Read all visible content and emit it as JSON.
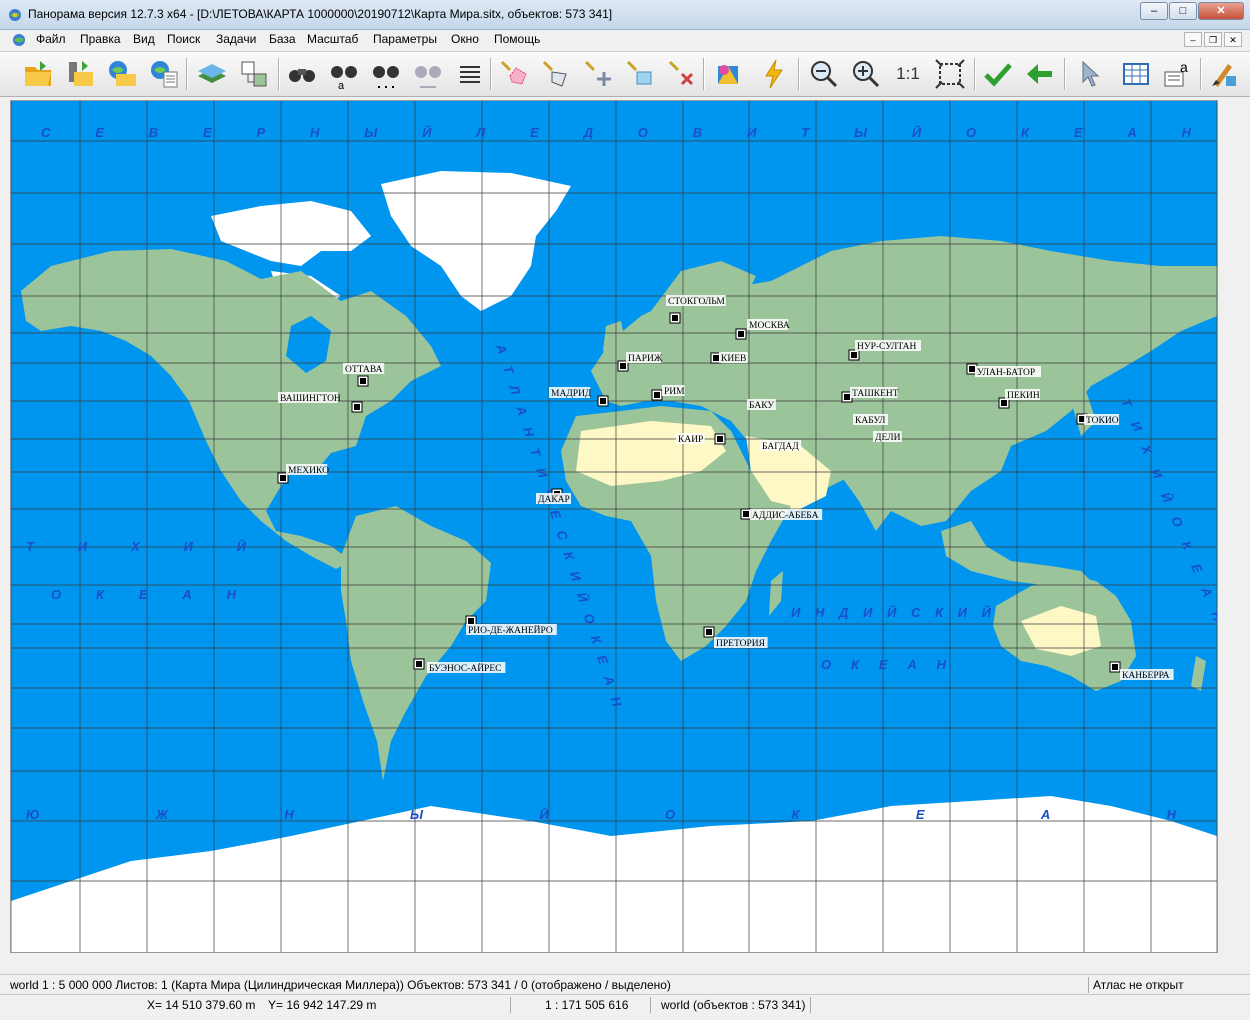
{
  "window": {
    "title": "Панорама версия 12.7.3 x64 - [D:\\ЛЕТОВА\\КАРТА 1000000\\20190712\\Карта Мира.sitx, объектов: 573 341]",
    "minimize": "–",
    "maximize": "□",
    "close": "✕"
  },
  "menu": {
    "items": [
      "Файл",
      "Правка",
      "Вид",
      "Поиск",
      "Задачи",
      "База",
      "Масштаб",
      "Параметры",
      "Окно",
      "Помощь"
    ],
    "mdi_minimize": "–",
    "mdi_restore": "❐",
    "mdi_close": "✕"
  },
  "toolbar": {
    "scale_1_1": "1:1",
    "icons": [
      "open-folder-icon",
      "open-data-icon",
      "open-remote-icon",
      "open-geoportal-icon",
      "layers-icon",
      "map-list-icon",
      "search-binoculars-icon",
      "search-by-name-icon",
      "search-by-area-icon",
      "search-next-icon",
      "object-list-icon",
      "select-object-icon",
      "select-area-icon",
      "add-object-icon",
      "map-paint-icon",
      "delete-select-icon",
      "color-palette-icon",
      "lightning-icon",
      "zoom-out-icon",
      "zoom-in-icon",
      "scale-1-1-icon",
      "fit-window-icon",
      "apply-check-icon",
      "back-arrow-icon",
      "pointer-icon",
      "table-icon",
      "text-edit-icon",
      "paint-brush-icon"
    ]
  },
  "map": {
    "colors": {
      "ocean": "#0096f0",
      "land": "#9cc49b",
      "ice": "#ffffff",
      "desert": "#fdf8c6",
      "grid": "#3a3a3a",
      "ocean_text": "#1a4fc7"
    },
    "ocean_labels": [
      {
        "text": "С  Е  В  Е  Р  Н  Ы  Й     Л  Е  Д  О  В  И  Т  Ы  Й     О  К  Е  А  Н"
      },
      {
        "text": "Т  И  Х  И  Й"
      },
      {
        "text": "О  К  Е  А  Н"
      },
      {
        "text": "А  Т  Л  А  Н  Т  И  Ч  Е  С  К  И  Й     О  К  Е  А  Н"
      },
      {
        "text": "И  Н  Д  И  Й  С  К  И  Й"
      },
      {
        "text": "О  К  Е  А  Н"
      },
      {
        "text": "Т  И  Х  И  Й     О  К  Е  А  Н"
      },
      {
        "text": "Ю     Ж     Н     Ы     Й     О     К     Е     А     Н"
      }
    ],
    "cities": [
      "СТОКГОЛЬМ",
      "МОСКВА",
      "ПАРИЖ",
      "КИЕВ",
      "НУР-СУЛТАН",
      "УЛАН-БАТОР",
      "ОТТАВА",
      "МАДРИД",
      "РИМ",
      "ТАШКЕНТ",
      "ПЕКИН",
      "ВАШИНГТОН",
      "БАКУ",
      "КАБУЛ",
      "ТОКИО",
      "КАИР",
      "БАГДАД",
      "ДЕЛИ",
      "МЕХИКО",
      "ДАКАР",
      "АДДИС-АБЕБА",
      "РИО-ДЕ-ЖАНЕЙРО",
      "ПРЕТОРИЯ",
      "БУЭНОС-АЙРЕС",
      "КАНБЕРРА"
    ]
  },
  "status": {
    "line1": "world  1 : 5 000 000  Листов: 1   (Карта Мира (Цилиндрическая Миллера))  Объектов: 573 341 / 0 (отображено / выделено)",
    "atlas": "Атлас не открыт",
    "x": "X= 14 510 379.60 m",
    "y": "Y= 16 942 147.29 m",
    "scale": "1 : 171 505 616",
    "world": "world   (объектов : 573 341)"
  }
}
